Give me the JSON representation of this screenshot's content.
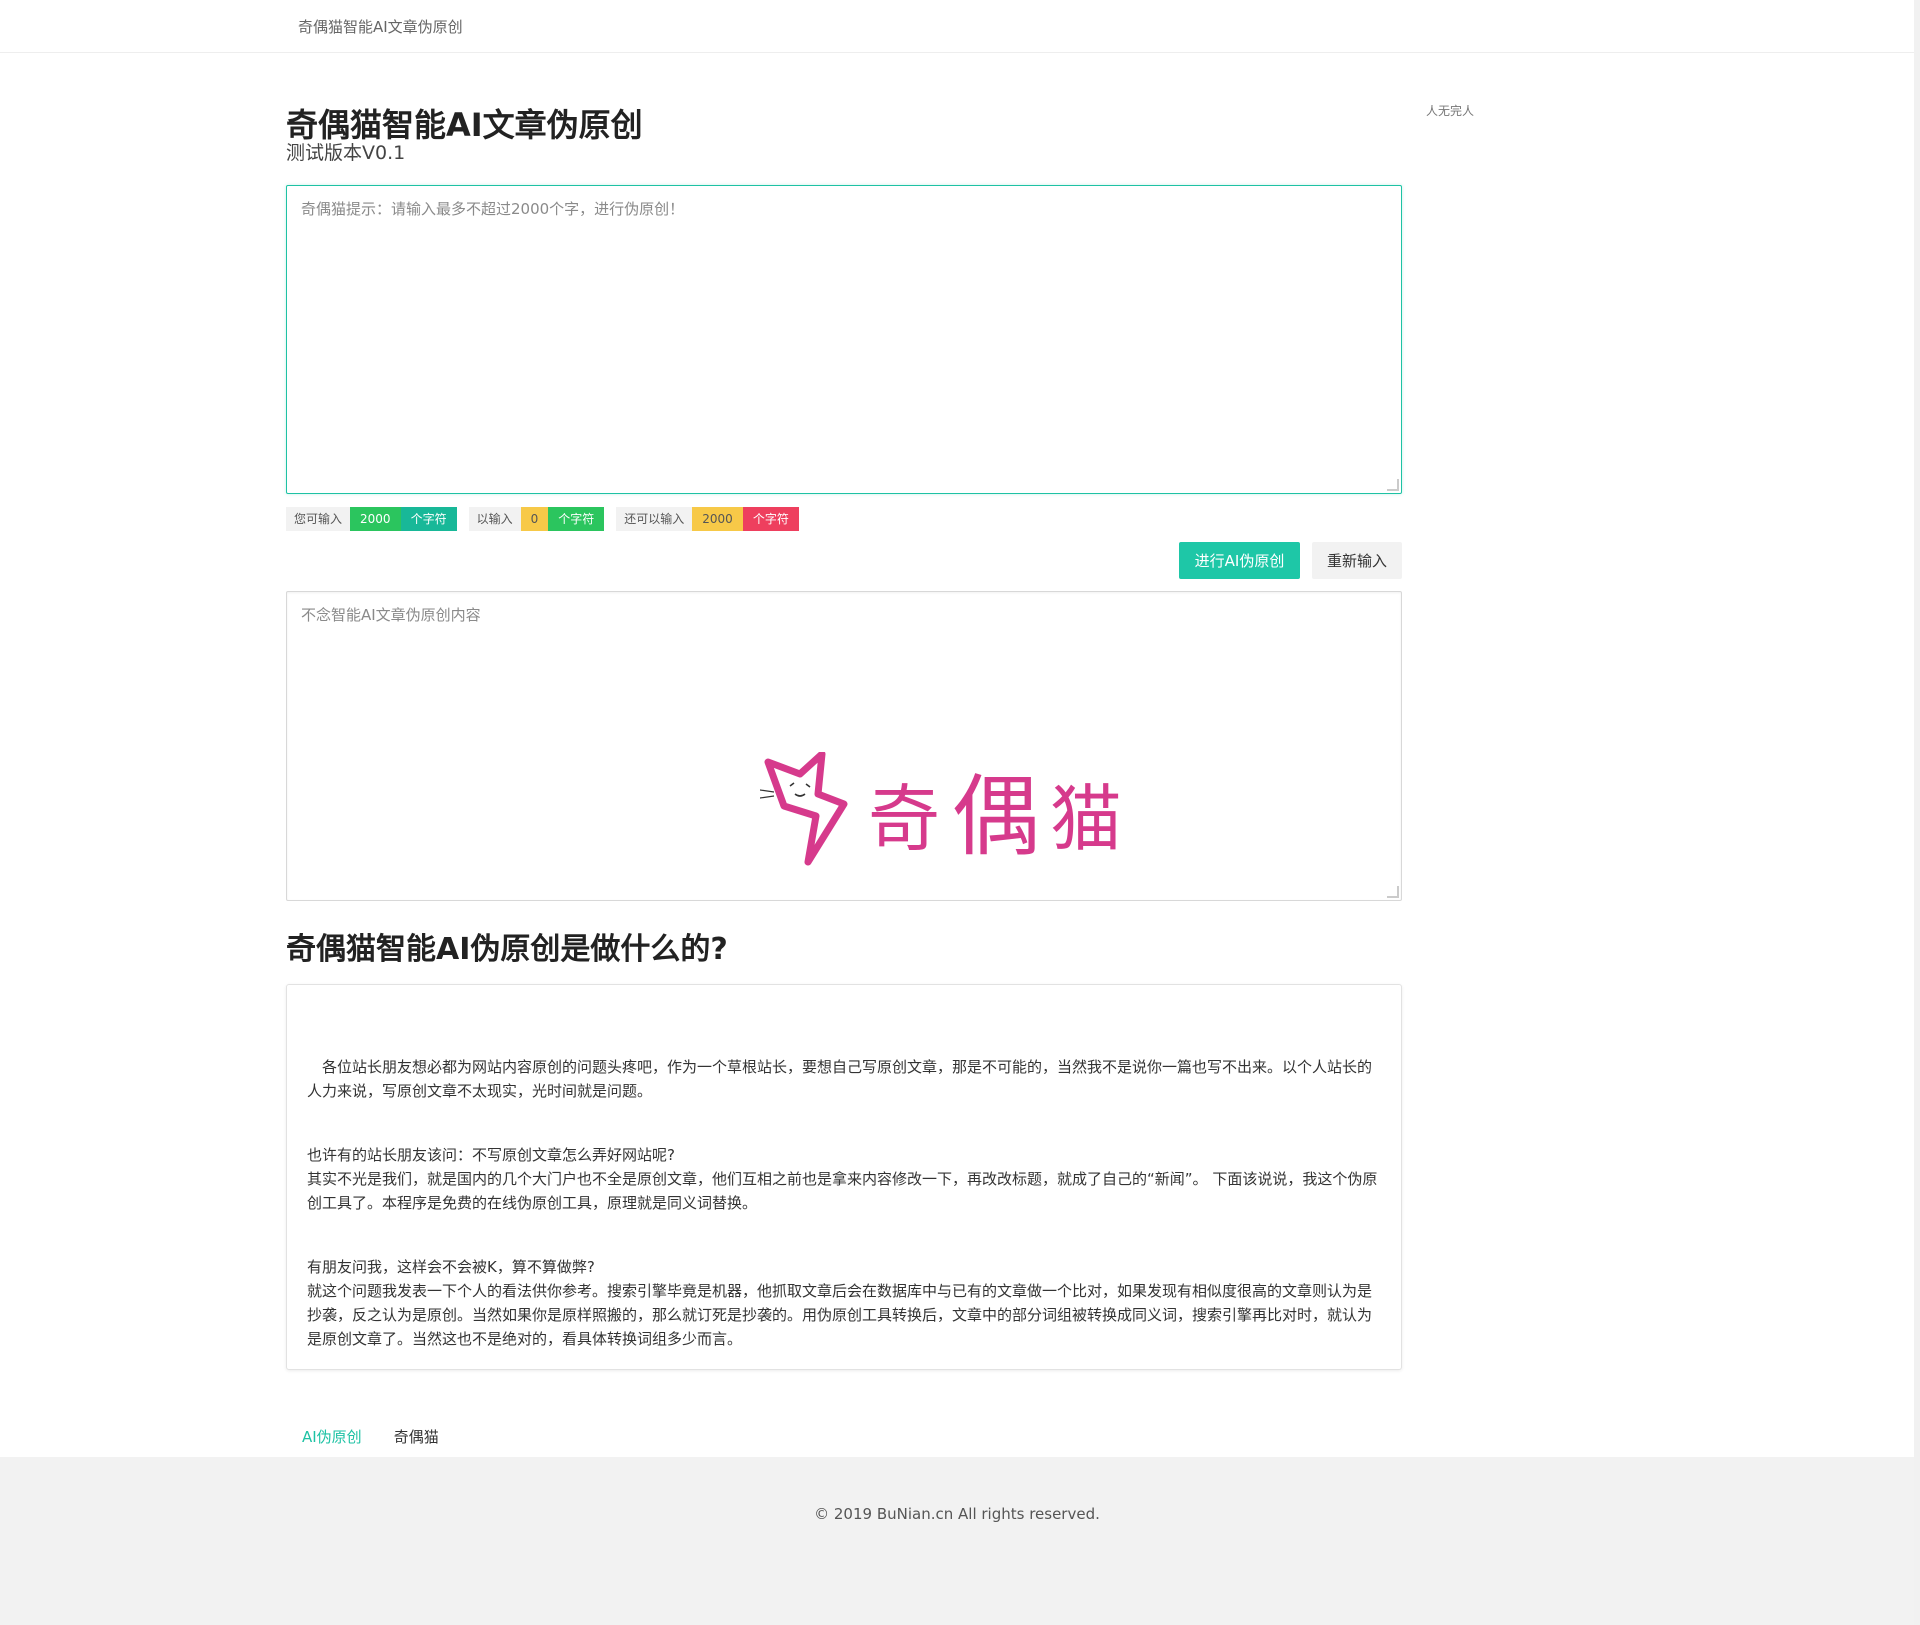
{
  "header": {
    "brand": "奇偶猫智能AI文章伪原创"
  },
  "side_note": "人无完人",
  "page": {
    "title": "奇偶猫智能AI文章伪原创",
    "subtitle": "测试版本V0.1"
  },
  "input": {
    "placeholder": "奇偶猫提示：请输入最多不超过2000个字，进行伪原创！",
    "value": ""
  },
  "counters": [
    {
      "label": "您可输入",
      "value": "2000",
      "unit": "个字符"
    },
    {
      "label": "以输入",
      "value": "0",
      "unit": "个字符"
    },
    {
      "label": "还可以输入",
      "value": "2000",
      "unit": "个字符"
    }
  ],
  "buttons": {
    "submit": "进行AI伪原创",
    "reset": "重新输入"
  },
  "output": {
    "placeholder": "不念智能AI文章伪原创内容"
  },
  "logo": {
    "icon": "lightning-cat-icon",
    "chars": [
      "奇",
      "偶",
      "猫"
    ],
    "color": "#d63a8c"
  },
  "section": {
    "title": "奇偶猫智能AI伪原创是做什么的?",
    "paragraphs": [
      "　各位站长朋友想必都为网站内容原创的问题头疼吧，作为一个草根站长，要想自己写原创文章，那是不可能的，当然我不是说你一篇也写不出来。以个人站长的人力来说，写原创文章不太现实，光时间就是问题。",
      "也许有的站长朋友该问：不写原创文章怎么弄好网站呢?",
      "其实不光是我们，就是国内的几个大门户也不全是原创文章，他们互相之前也是拿来内容修改一下，再改改标题，就成了自己的“新闻”。 下面该说说，我这个伪原创工具了。本程序是免费的在线伪原创工具，原理就是同义词替换。",
      "有朋友问我，这样会不会被K，算不算做弊?",
      "就这个问题我发表一下个人的看法供你参考。搜索引擎毕竟是机器，他抓取文章后会在数据库中与已有的文章做一个比对，如果发现有相似度很高的文章则认为是抄袭，反之认为是原创。当然如果你是原样照搬的，那么就订死是抄袭的。用伪原创工具转换后，文章中的部分词组被转换成同义词，搜索引擎再比对时，就认为是原创文章了。当然这也不是绝对的，看具体转换词组多少而言。"
    ]
  },
  "footer_links": [
    {
      "label": "AI伪原创"
    },
    {
      "label": "奇偶猫"
    }
  ],
  "footer": {
    "copyright": "© 2019 BuNian.cn All rights reserved."
  },
  "colors": {
    "accent": "#1ec2a4",
    "logo": "#d63a8c"
  }
}
